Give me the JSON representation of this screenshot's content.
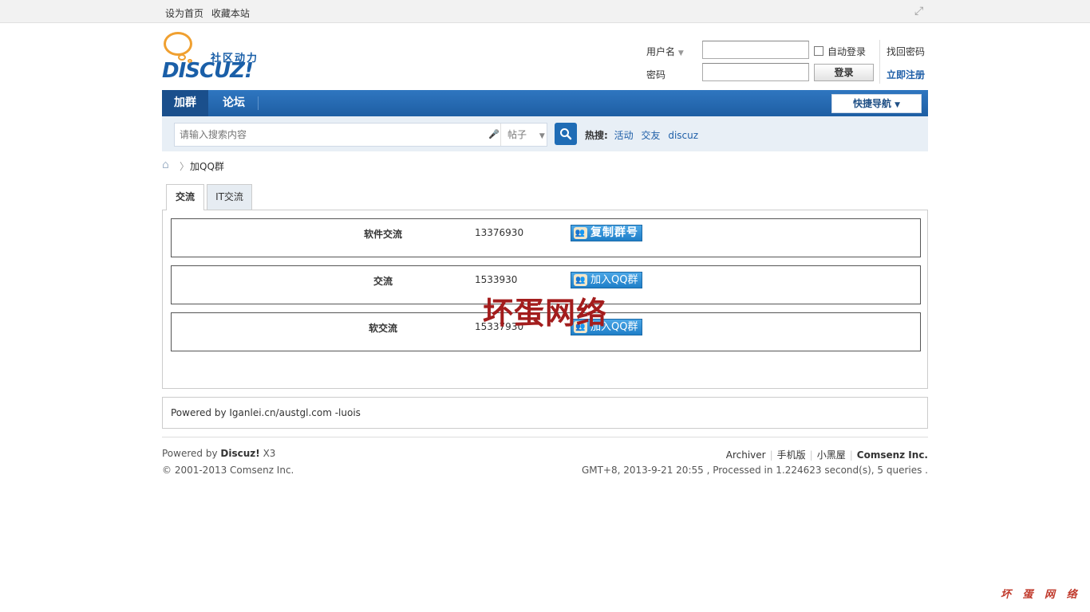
{
  "topbar": {
    "set_home": "设为首页",
    "bookmark": "收藏本站"
  },
  "logo": {
    "brand": "DISCUZ!",
    "tagline": "社区动力"
  },
  "login": {
    "username_label": "用户名",
    "password_label": "密码",
    "auto_login": "自动登录",
    "login_button": "登录",
    "forgot_password": "找回密码",
    "register": "立即注册"
  },
  "nav": {
    "items": [
      {
        "label": "加群"
      },
      {
        "label": "论坛"
      }
    ],
    "quick_nav": "快捷导航"
  },
  "search": {
    "placeholder": "请输入搜索内容",
    "scope": "帖子",
    "hot_label": "热搜:",
    "hot_items": [
      "活动",
      "交友",
      "discuz"
    ]
  },
  "breadcrumb": {
    "current": "加QQ群"
  },
  "tabs": [
    {
      "label": "交流"
    },
    {
      "label": "IT交流"
    }
  ],
  "groups": [
    {
      "name": "软件交流",
      "number": "13376930",
      "button": "复制群号"
    },
    {
      "name": "交流",
      "number": "1533930",
      "button": "加入QQ群"
    },
    {
      "name": "软交流",
      "number": "15337930",
      "button": "加入QQ群"
    }
  ],
  "watermark": "坏蛋网络",
  "powered_box": "Powered by Iganlei.cn/austgl.com -luois",
  "footer": {
    "powered_prefix": "Powered by",
    "powered_brand": "Discuz!",
    "powered_version": "X3",
    "copyright": "© 2001-2013 Comsenz Inc.",
    "links": [
      "Archiver",
      "手机版",
      "小黑屋"
    ],
    "company": "Comsenz Inc.",
    "stats": "GMT+8, 2013-9-21 20:55 , Processed in 1.224623 second(s), 5 queries ."
  },
  "corner_mark": "坏 蛋 网 络",
  "colors": {
    "nav_blue": "#1e5ea3",
    "link_blue": "#1f5fa8",
    "watermark_red": "#a31d1d"
  }
}
